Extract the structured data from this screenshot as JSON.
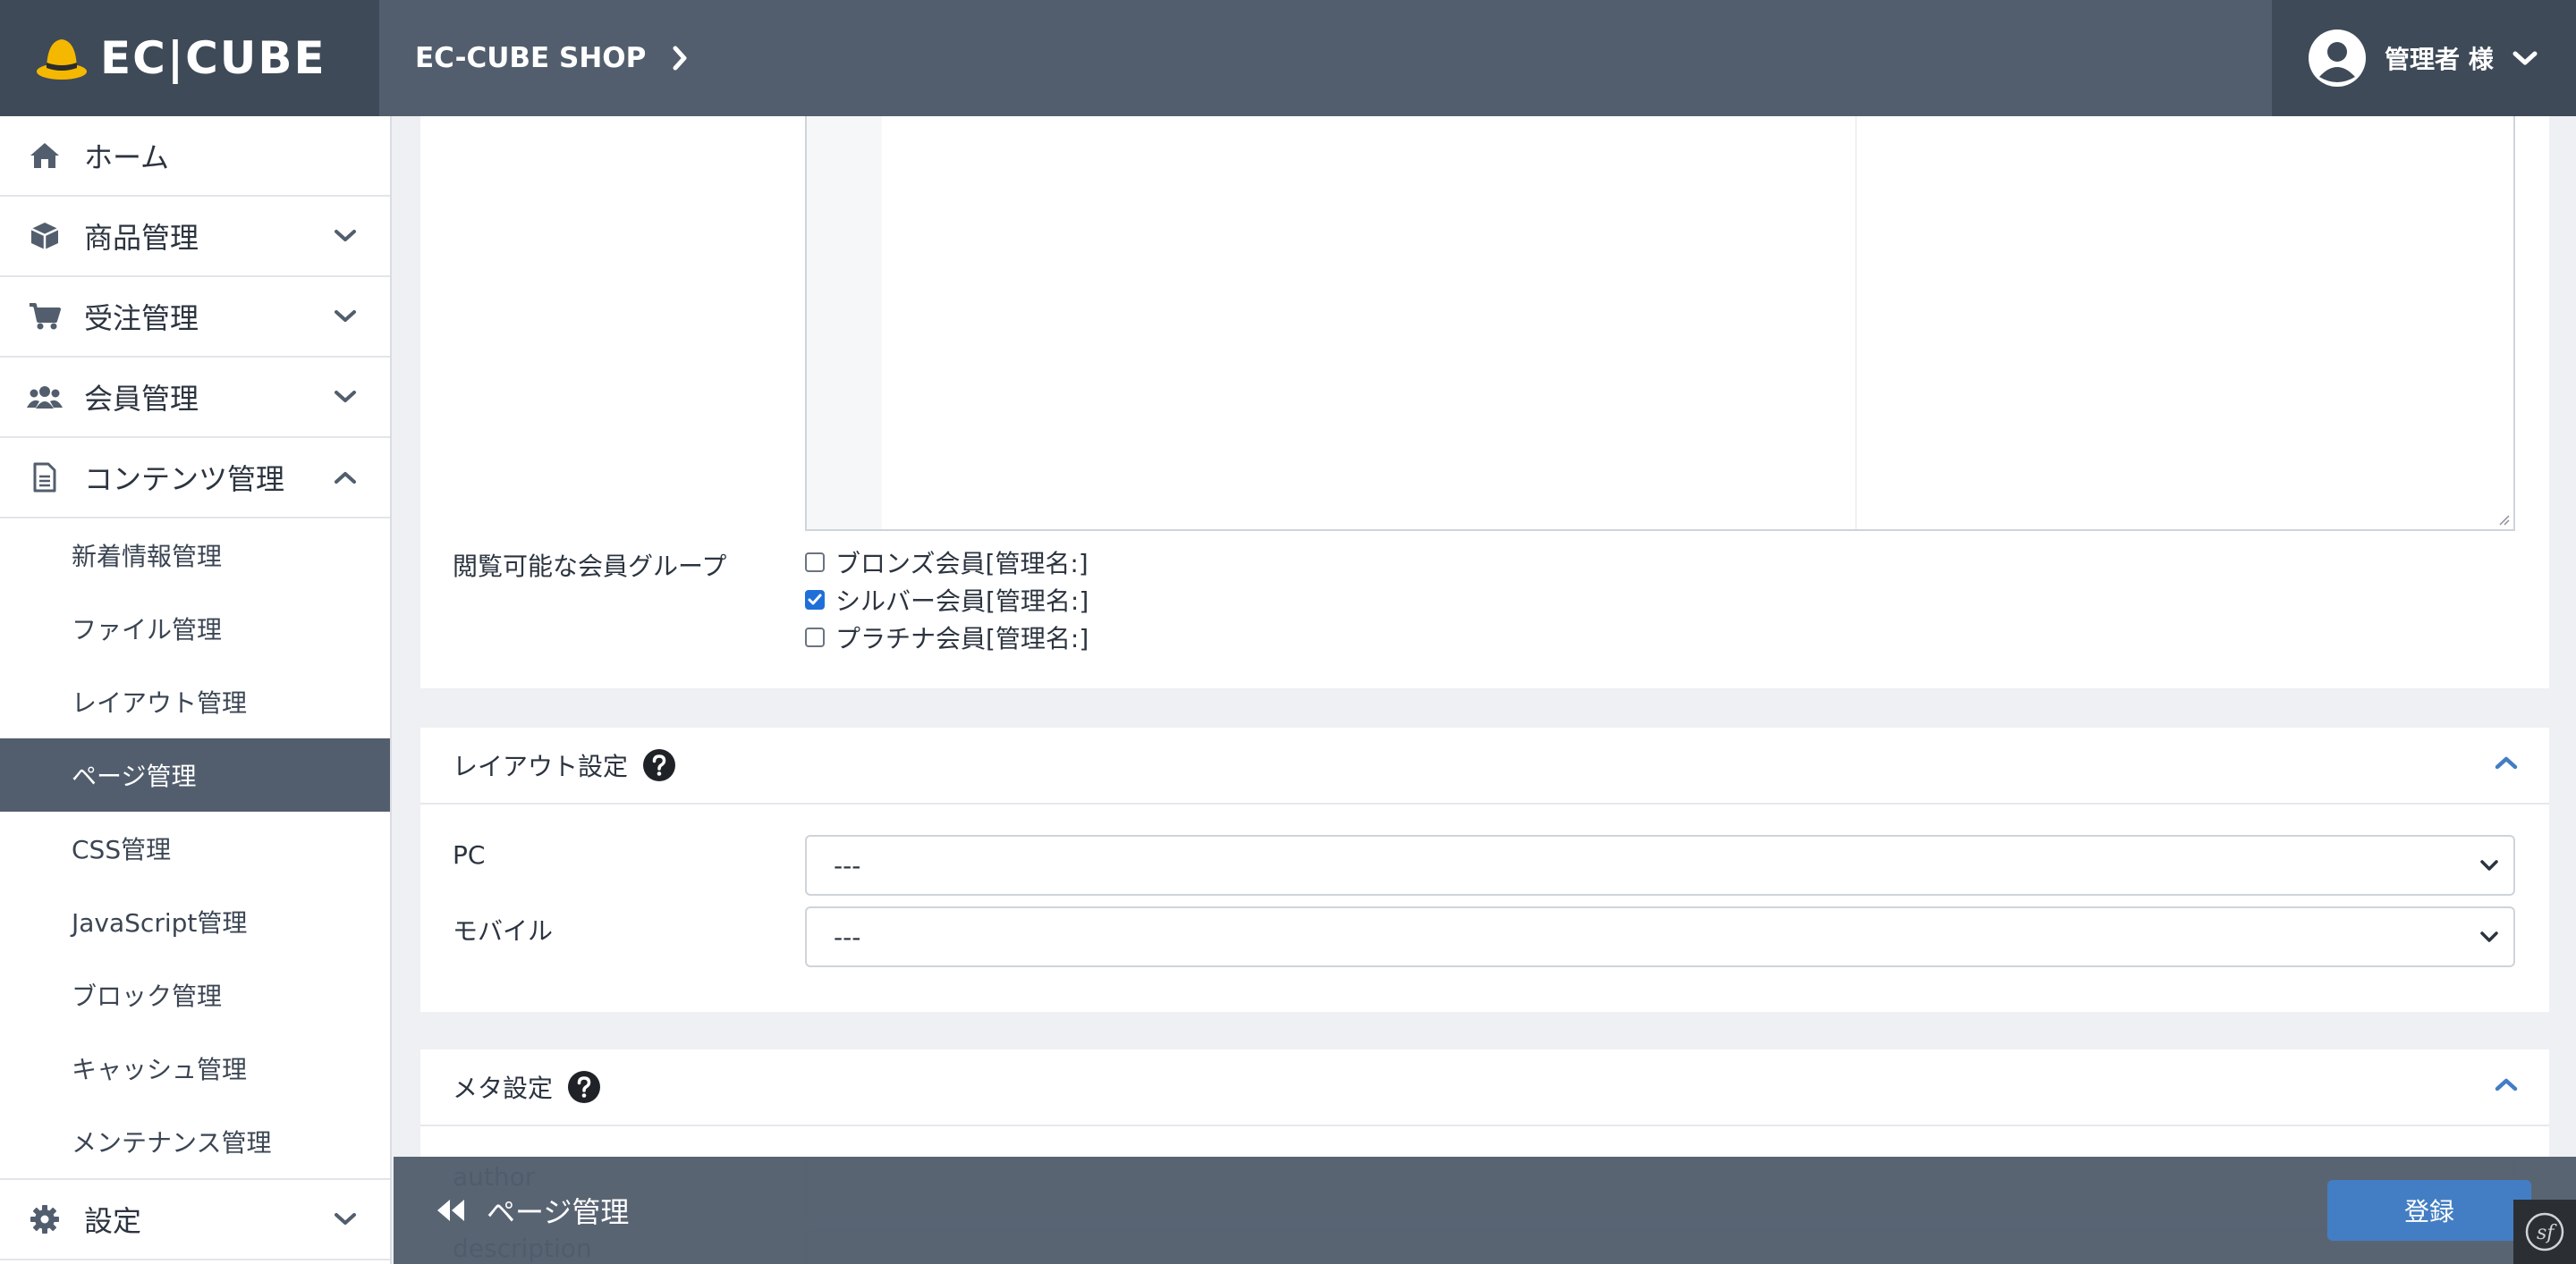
{
  "header": {
    "logo_text": "EC|CUBE",
    "shop_name": "EC-CUBE SHOP",
    "user_name": "管理者 様"
  },
  "sidebar": {
    "items": [
      {
        "label": "ホーム",
        "icon": "home-icon"
      },
      {
        "label": "商品管理",
        "icon": "box-icon"
      },
      {
        "label": "受注管理",
        "icon": "cart-icon"
      },
      {
        "label": "会員管理",
        "icon": "users-icon"
      },
      {
        "label": "コンテンツ管理",
        "icon": "file-icon"
      }
    ],
    "sub_items": [
      "新着情報管理",
      "ファイル管理",
      "レイアウト管理",
      "ページ管理",
      "CSS管理",
      "JavaScript管理",
      "ブロック管理",
      "キャッシュ管理",
      "メンテナンス管理"
    ],
    "active_sub": "ページ管理",
    "settings_label": "設定"
  },
  "content": {
    "member_group_label": "閲覧可能な会員グループ",
    "member_groups": [
      {
        "label": "ブロンズ会員[管理名:]",
        "checked": false
      },
      {
        "label": "シルバー会員[管理名:]",
        "checked": true
      },
      {
        "label": "プラチナ会員[管理名:]",
        "checked": false
      }
    ]
  },
  "layout_settings": {
    "title": "レイアウト設定",
    "pc_label": "PC",
    "pc_value": "---",
    "mobile_label": "モバイル",
    "mobile_value": "---"
  },
  "meta_settings": {
    "title": "メタ設定",
    "author_label": "author",
    "description_label": "description"
  },
  "footer": {
    "back_label": "ページ管理",
    "register_label": "登録"
  },
  "colors": {
    "header": "#525e6d",
    "header_dark": "#3f4a58",
    "primary_button": "#437ec4",
    "checkbox_checked": "#1f6fd9"
  }
}
